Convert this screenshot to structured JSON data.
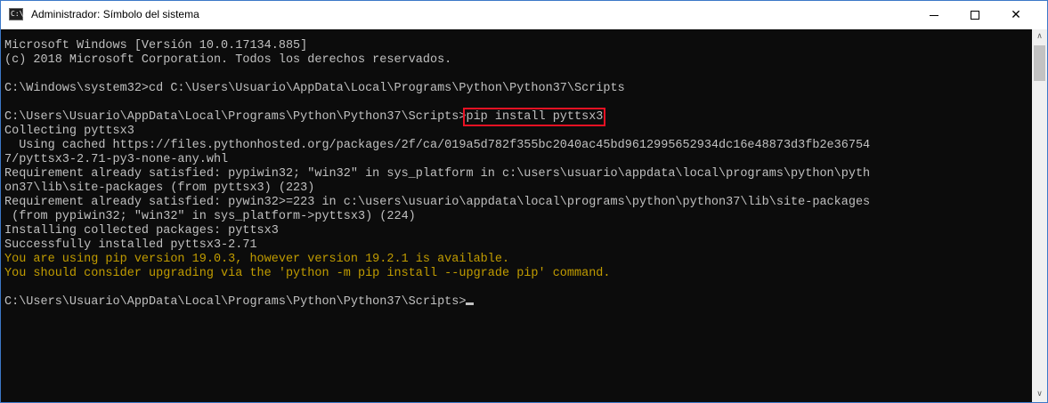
{
  "window": {
    "title": "Administrador: Símbolo del sistema",
    "icon": "cmd-icon",
    "icon_text": "C:\\",
    "controls": {
      "minimize_icon": "minimize-icon",
      "maximize_icon": "maximize-icon",
      "close_icon": "close-icon",
      "close_glyph": "✕"
    }
  },
  "console": {
    "text_color": "#c0c0c0",
    "warning_color": "#c19c00",
    "highlight_color": "#e81123",
    "lines": [
      "Microsoft Windows [Versión 10.0.17134.885]",
      "(c) 2018 Microsoft Corporation. Todos los derechos reservados.",
      "",
      "C:\\Windows\\system32>cd C:\\Users\\Usuario\\AppData\\Local\\Programs\\Python\\Python37\\Scripts",
      "",
      "C:\\Users\\Usuario\\AppData\\Local\\Programs\\Python\\Python37\\Scripts>",
      "Collecting pyttsx3",
      "  Using cached https://files.pythonhosted.org/packages/2f/ca/019a5d782f355bc2040ac45bd9612995652934dc16e48873d3fb2e36754",
      "7/pyttsx3-2.71-py3-none-any.whl",
      "Requirement already satisfied: pypiwin32; \"win32\" in sys_platform in c:\\users\\usuario\\appdata\\local\\programs\\python\\pyth",
      "on37\\lib\\site-packages (from pyttsx3) (223)",
      "Requirement already satisfied: pywin32>=223 in c:\\users\\usuario\\appdata\\local\\programs\\python\\python37\\lib\\site-packages",
      " (from pypiwin32; \"win32\" in sys_platform->pyttsx3) (224)",
      "Installing collected packages: pyttsx3",
      "Successfully installed pyttsx3-2.71",
      "You are using pip version 19.0.3, however version 19.2.1 is available.",
      "You should consider upgrading via the 'python -m pip install --upgrade pip' command.",
      "",
      "C:\\Users\\Usuario\\AppData\\Local\\Programs\\Python\\Python37\\Scripts>"
    ],
    "highlighted_command": "pip install pyttsx3"
  },
  "scrollbar": {
    "up_icon": "scroll-up-arrow-icon",
    "down_icon": "scroll-down-arrow-icon",
    "up_glyph": "∧",
    "down_glyph": "∨"
  }
}
